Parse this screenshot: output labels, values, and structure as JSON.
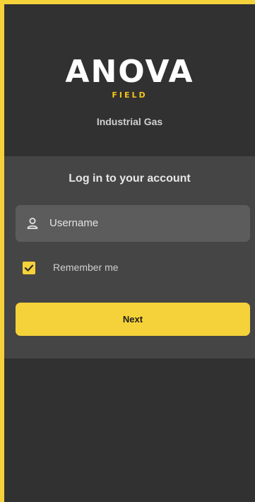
{
  "brand": {
    "logo_text": "ANOVA",
    "logo_subtext": "FIELD",
    "tagline": "Industrial Gas"
  },
  "login": {
    "title": "Log in to your account",
    "username_placeholder": "Username",
    "remember_label": "Remember me",
    "remember_checked": true,
    "next_label": "Next"
  },
  "colors": {
    "accent": "#f6d23a",
    "background": "#313131",
    "card": "#454545",
    "input": "#5c5c5c"
  },
  "icons": {
    "username": "user-icon",
    "checkbox": "checkmark-icon"
  }
}
